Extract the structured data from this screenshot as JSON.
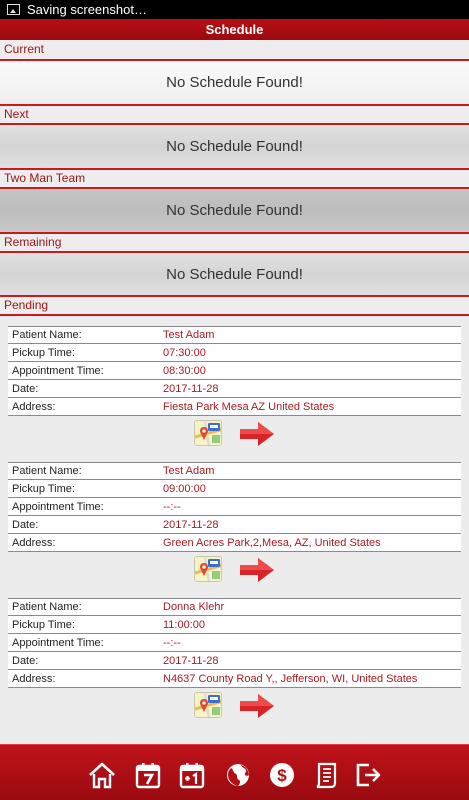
{
  "status_bar": {
    "text": "Saving screenshot…"
  },
  "header": {
    "title": "Schedule"
  },
  "sections": [
    {
      "label": "Current",
      "message": "No Schedule Found!"
    },
    {
      "label": "Next",
      "message": "No Schedule Found!"
    },
    {
      "label": "Two Man Team",
      "message": "No Schedule Found!"
    },
    {
      "label": "Remaining",
      "message": "No Schedule Found!"
    }
  ],
  "pending": {
    "label": "Pending",
    "field_labels": {
      "patient": "Patient Name:",
      "pickup": "Pickup Time:",
      "appointment": "Appointment  Time:",
      "date": "Date:",
      "address": "Address:"
    },
    "items": [
      {
        "patient": "Test Adam",
        "pickup": "07:30:00",
        "appointment": "08:30:00",
        "date": "2017-11-28",
        "address": "Fiesta Park Mesa AZ United States"
      },
      {
        "patient": "Test Adam",
        "pickup": "09:00:00",
        "appointment": "--:--",
        "date": "2017-11-28",
        "address": "Green Acres Park,2,Mesa, AZ, United States"
      },
      {
        "patient": "Donna Klehr",
        "pickup": "11:00:00",
        "appointment": "--:--",
        "date": "2017-11-28",
        "address": "N4637 County Road Y,, Jefferson, WI, United States"
      }
    ]
  },
  "bottom_nav": [
    "home-icon",
    "calendar-icon",
    "calendar-plus-one-icon",
    "globe-icon",
    "dollar-icon",
    "receipt-icon",
    "logout-icon"
  ],
  "colors": {
    "brand_red": "#b80f15",
    "value_red": "#a51c22"
  }
}
